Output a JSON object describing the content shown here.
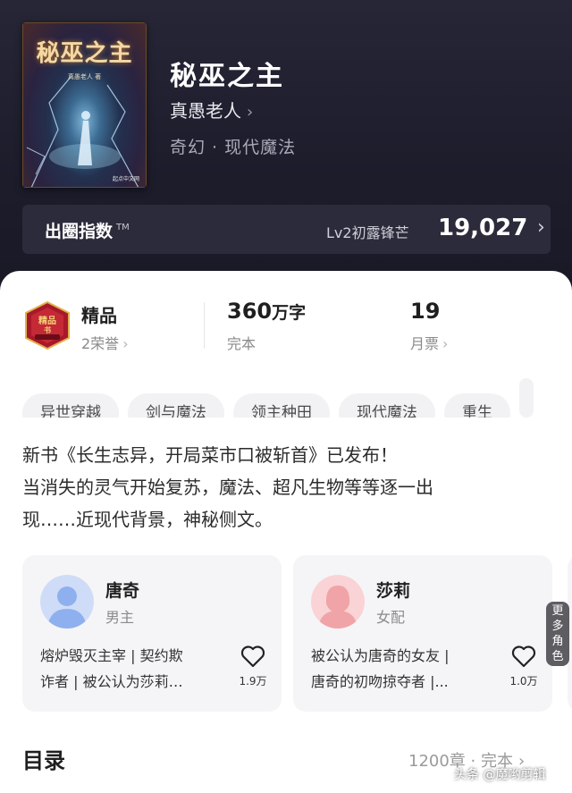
{
  "book": {
    "cover_title": "秘巫之主",
    "cover_author": "真愚老人 著",
    "cover_publisher": "起点中文网",
    "title": "秘巫之主",
    "author": "真愚老人",
    "genre": "奇幻 · 现代魔法"
  },
  "index": {
    "label": "出圈指数",
    "trademark": "TM",
    "level": "Lv2初露锋芒",
    "value": "19,027"
  },
  "stats": {
    "quality_title": "精品",
    "honors": "2荣誉",
    "word_count": "360",
    "word_unit": "万字",
    "status": "完本",
    "monthly_votes": "19",
    "monthly_label": "月票"
  },
  "tags": [
    "异世穿越",
    "剑与魔法",
    "领主种田",
    "现代魔法",
    "重生"
  ],
  "description": {
    "line1": "新书《长生志异，开局菜市口被斩首》已发布！",
    "line2": "当消失的灵气开始复苏，魔法、超凡生物等等逐一出",
    "line3": "现……近现代背景，神秘侧文。"
  },
  "characters": [
    {
      "name": "唐奇",
      "role": "男主",
      "desc_line1": "熔炉毁灭主宰 | 契约欺",
      "desc_line2": "诈者 | 被公认为莎莉…",
      "likes": "1.9万"
    },
    {
      "name": "莎莉",
      "role": "女配",
      "desc_line1": "被公认为唐奇的女友 |",
      "desc_line2": "唐奇的初吻掠夺者 |...",
      "likes": "1.0万"
    }
  ],
  "more_roles": [
    "更",
    "多",
    "角",
    "色"
  ],
  "toc": {
    "title": "目录",
    "meta": "1200章 · 完本"
  },
  "watermark": "头条 @魔哟剪辑",
  "colors": {
    "header_bg": "#1c1c2b",
    "sheet_bg": "#ffffff",
    "tag_bg": "#f2f2f4",
    "card_bg": "#f5f5f7",
    "male_avatar": "#8fb0ee",
    "female_avatar": "#f0a4a8"
  }
}
